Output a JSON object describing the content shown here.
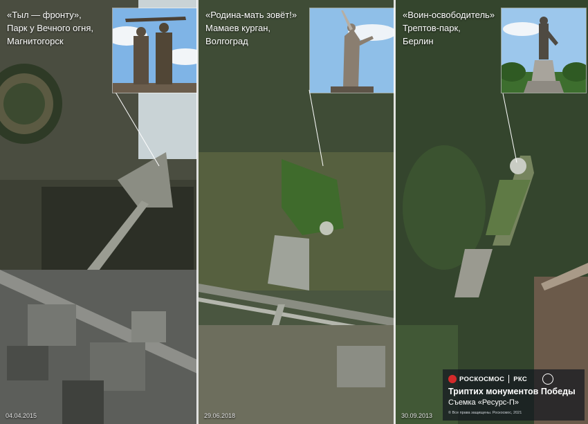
{
  "panels": [
    {
      "caption": [
        "«Тыл — фронту»,",
        "Парк у Вечного огня,",
        "Магнитогорск"
      ],
      "date": "04.04.2015"
    },
    {
      "caption": [
        "«Родина-мать зовёт!»",
        "Мамаев курган,",
        "Волгоград"
      ],
      "date": "29.06.2018"
    },
    {
      "caption": [
        "«Воин-освободитель»",
        "Трептов-парк,",
        "Берлин"
      ],
      "date": "30.09.2013"
    }
  ],
  "brand": {
    "roscosmos": "РОСКОСМОС",
    "rks": "РКС",
    "title": "Триптих монументов Победы",
    "subtitle": "Съемка «Ресурс-П»",
    "copyright": "© Все права защищены. Роскосмос, 2021"
  },
  "colors": {
    "forest": "#2f3d2a",
    "text": "#ffffff",
    "brand_bg": "#141820"
  }
}
